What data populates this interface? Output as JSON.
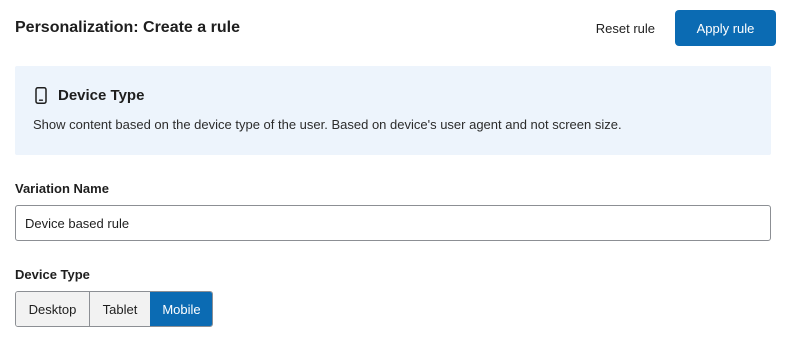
{
  "header": {
    "title": "Personalization: Create a rule",
    "reset_label": "Reset rule",
    "apply_label": "Apply rule"
  },
  "info": {
    "icon": "mobile-device-icon",
    "title": "Device Type",
    "description": "Show content based on the device type of the user. Based on device's user agent and not screen size."
  },
  "variation": {
    "label": "Variation Name",
    "value": "Device based rule"
  },
  "device_type": {
    "label": "Device Type",
    "options": [
      "Desktop",
      "Tablet",
      "Mobile"
    ],
    "selected": "Mobile"
  },
  "colors": {
    "accent": "#0b6bb3",
    "panel_bg": "#edf4fc",
    "border": "#8c8f94"
  }
}
